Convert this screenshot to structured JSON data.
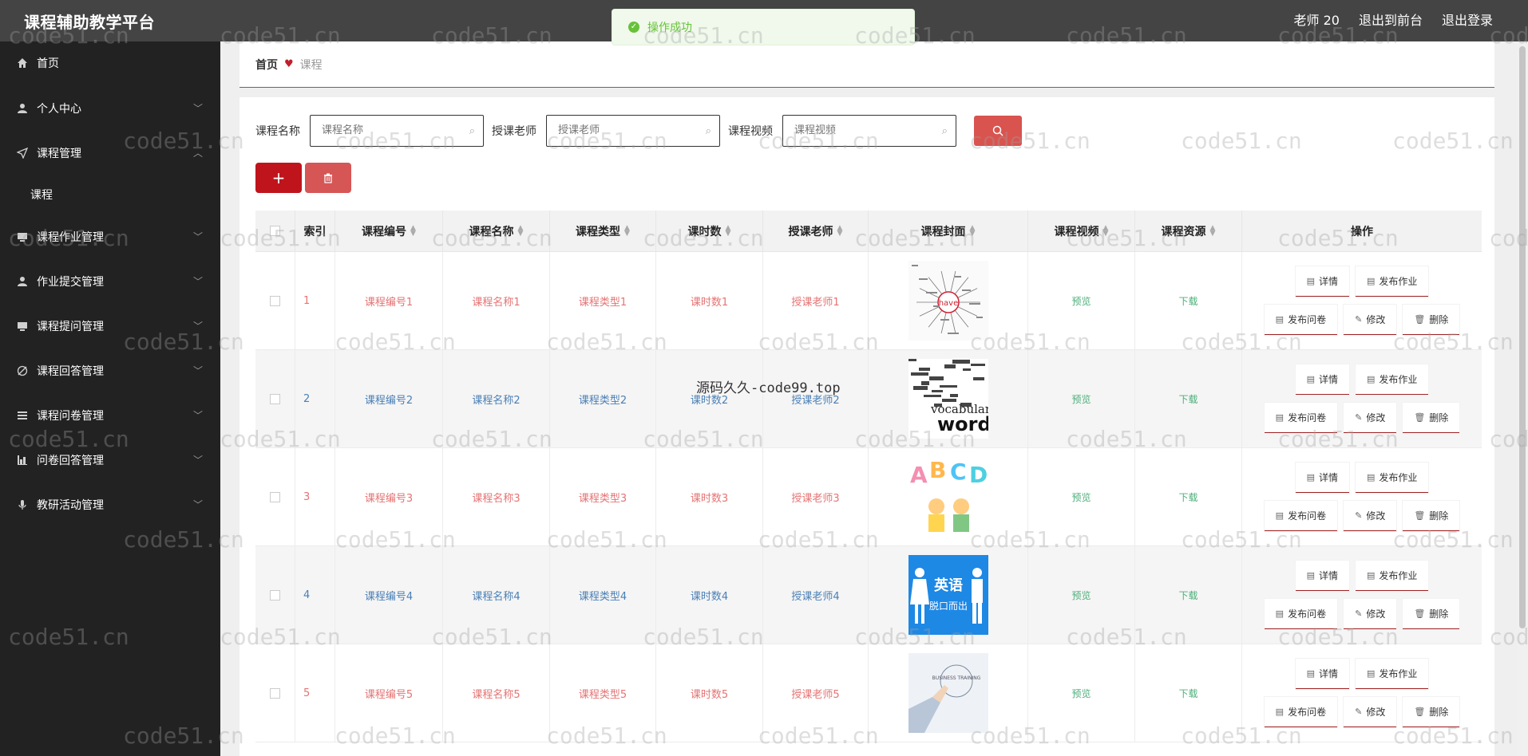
{
  "header": {
    "title": "课程辅助教学平台",
    "user": "老师 20",
    "to_front": "退出到前台",
    "logout": "退出登录"
  },
  "toast": {
    "message": "操作成功"
  },
  "sidebar": {
    "items": [
      {
        "label": "首页",
        "icon": "home-icon"
      },
      {
        "label": "个人中心",
        "icon": "user-icon"
      },
      {
        "label": "课程管理",
        "icon": "send-icon",
        "expanded": true
      },
      {
        "label": "课程",
        "sub": true
      },
      {
        "label": "课程作业管理",
        "icon": "folder-icon"
      },
      {
        "label": "作业提交管理",
        "icon": "user-icon"
      },
      {
        "label": "课程提问管理",
        "icon": "folder-icon"
      },
      {
        "label": "课程回答管理",
        "icon": "compass-icon"
      },
      {
        "label": "课程问卷管理",
        "icon": "list-icon"
      },
      {
        "label": "问卷回答管理",
        "icon": "chart-icon"
      },
      {
        "label": "教研活动管理",
        "icon": "mic-icon"
      }
    ]
  },
  "breadcrumb": {
    "home": "首页",
    "current": "课程"
  },
  "search": {
    "name_label": "课程名称",
    "name_placeholder": "课程名称",
    "teacher_label": "授课老师",
    "teacher_placeholder": "授课老师",
    "video_label": "课程视频",
    "video_placeholder": "课程视频"
  },
  "table": {
    "headers": [
      "索引",
      "课程编号",
      "课程名称",
      "课程类型",
      "课时数",
      "授课老师",
      "课程封面",
      "课程视频",
      "课程资源",
      "操作"
    ],
    "rows": [
      {
        "index": "1",
        "code": "课程编号1",
        "name": "课程名称1",
        "type": "课程类型1",
        "hours": "课时数1",
        "teacher": "授课老师1",
        "cover": "have-wordcloud",
        "video": "预览",
        "resource": "下载"
      },
      {
        "index": "2",
        "code": "课程编号2",
        "name": "课程名称2",
        "type": "课程类型2",
        "hours": "课时数2",
        "teacher": "授课老师2",
        "cover": "vocabulary-words",
        "video": "预览",
        "resource": "下载"
      },
      {
        "index": "3",
        "code": "课程编号3",
        "name": "课程名称3",
        "type": "课程类型3",
        "hours": "课时数3",
        "teacher": "授课老师3",
        "cover": "abcd-kids",
        "video": "预览",
        "resource": "下载"
      },
      {
        "index": "4",
        "code": "课程编号4",
        "name": "课程名称4",
        "type": "课程类型4",
        "hours": "课时数4",
        "teacher": "授课老师4",
        "cover": "english-speaking",
        "video": "预览",
        "resource": "下载"
      },
      {
        "index": "5",
        "code": "课程编号5",
        "name": "课程名称5",
        "type": "课程类型5",
        "hours": "课时数5",
        "teacher": "授课老师5",
        "cover": "business-training",
        "video": "预览",
        "resource": "下载"
      }
    ],
    "actions": {
      "detail": "详情",
      "publish_hw": "发布作业",
      "publish_q": "发布问卷",
      "edit": "修改",
      "delete": "删除"
    }
  },
  "cover_text": {
    "have": "have",
    "vocabulary": "vocabulary",
    "words": "words",
    "abcd": [
      "A",
      "B",
      "C",
      "D"
    ],
    "english": "英语",
    "fluency": "脱口而出",
    "business": "BUSINESS TRAINING"
  },
  "watermark": {
    "text": "code51.cn",
    "overlay": "源码久久-code99.top"
  },
  "colors": {
    "accent": "#c0141c",
    "sidebar": "#222222",
    "topbar": "#444444",
    "link_green": "#4caf7a"
  }
}
